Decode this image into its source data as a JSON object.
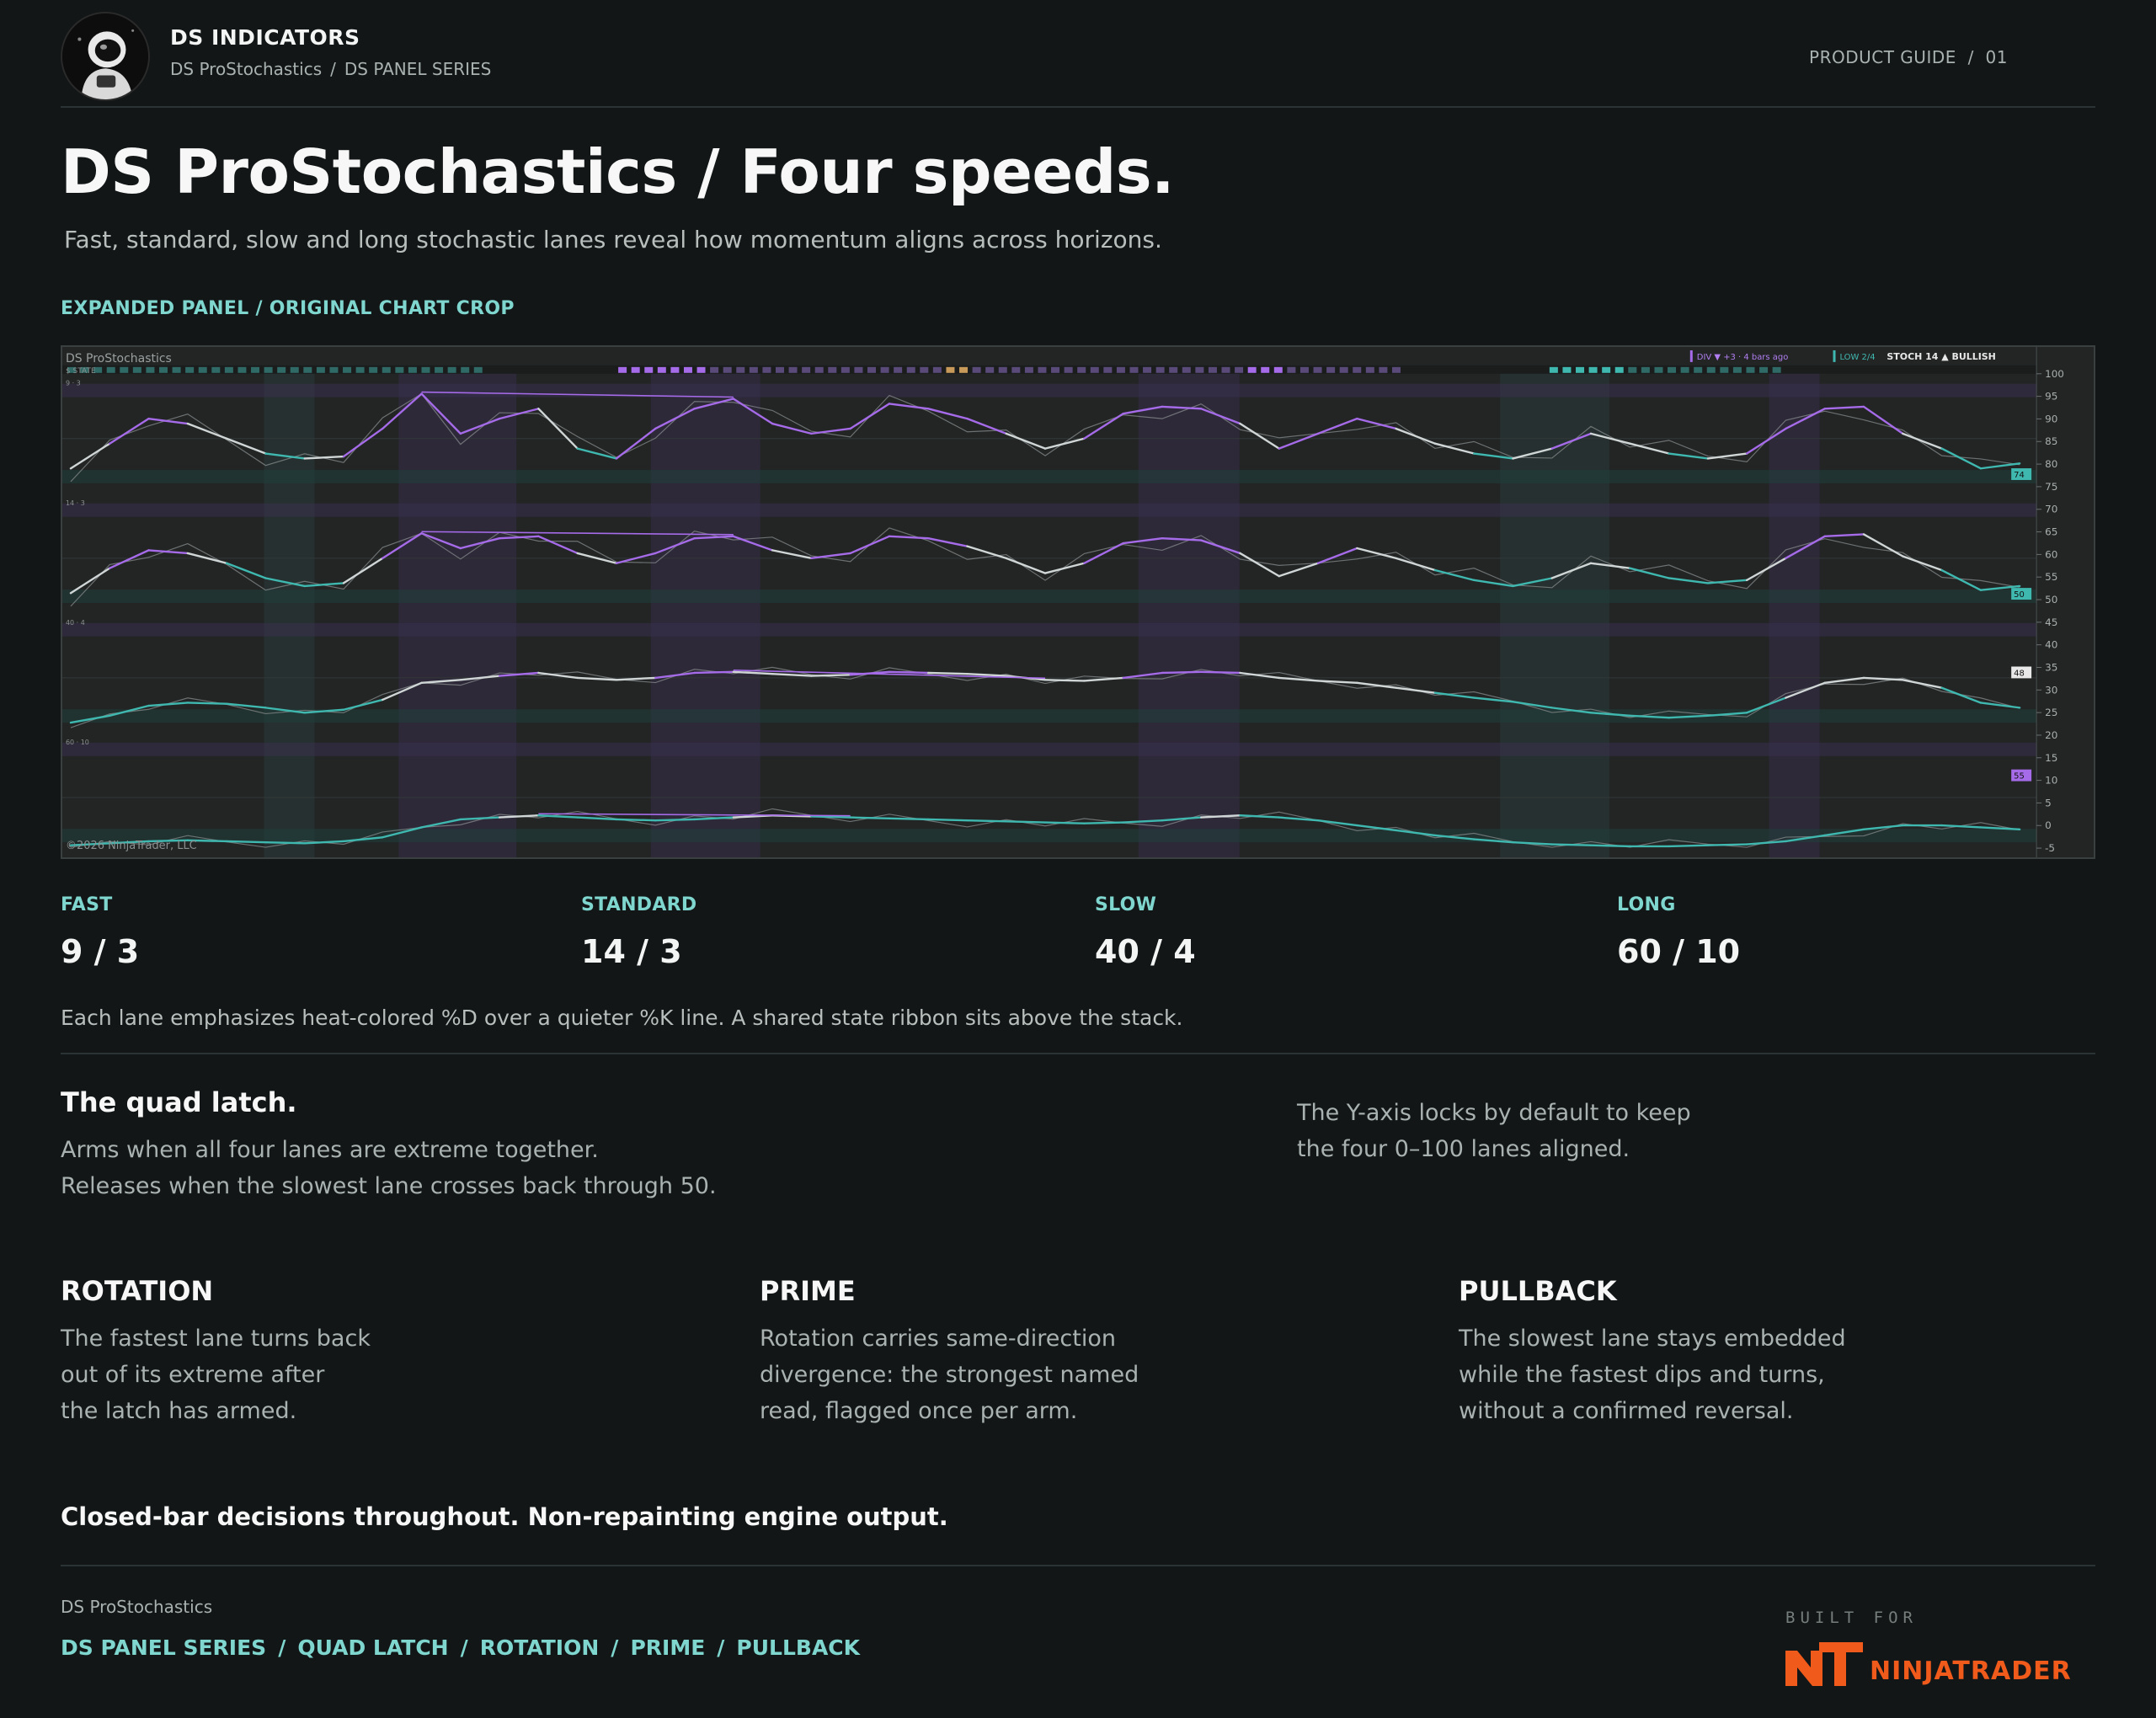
{
  "header": {
    "brand": "DS INDICATORS",
    "breadcrumb": [
      "DS ProStochastics",
      "DS PANEL SERIES"
    ],
    "breadcrumb_sep": "/",
    "guide": "PRODUCT GUIDE  /  01"
  },
  "hero": {
    "title": "DS ProStochastics / Four speeds.",
    "subtitle": "Fast, standard, slow and long stochastic lanes reveal how momentum aligns across horizons."
  },
  "chart_section": {
    "label": "EXPANDED PANEL / ORIGINAL CHART CROP",
    "panel_title": "DS ProStochastics",
    "state_label": "$  STATE",
    "badge_div": "DIV ▼  +3 · 4 bars ago",
    "badge_low": "LOW 2/4",
    "badge_stoch": "STOCH 14  ▲ BULLISH",
    "lane_tags": [
      "9 · 3",
      "14 · 3",
      "40 · 4",
      "60 · 10"
    ],
    "copyright": "©2026 NinjaTrader, LLC",
    "y_ticks": [
      "100",
      "95",
      "90",
      "85",
      "80",
      "75",
      "70",
      "65",
      "60",
      "55",
      "50",
      "45",
      "40",
      "35",
      "30",
      "25",
      "20",
      "15",
      "10",
      "5",
      "0",
      "-5"
    ],
    "axis_markers": [
      "74",
      "50",
      "48",
      "55"
    ]
  },
  "chart_data": {
    "type": "line",
    "title": "DS ProStochastics",
    "ylim": [
      -5,
      100
    ],
    "lanes": [
      {
        "name": "9 · 3",
        "series": [
          {
            "name": "%D",
            "values": [
              20,
              45,
              70,
              65,
              50,
              35,
              30,
              32,
              60,
              95,
              55,
              70,
              80,
              40,
              30,
              60,
              80,
              90,
              65,
              55,
              60,
              85,
              80,
              70,
              55,
              40,
              50,
              75,
              82,
              80,
              65,
              40,
              55,
              70,
              60,
              45,
              35,
              30,
              40,
              55,
              45,
              35,
              30,
              35,
              60,
              80,
              82,
              55,
              40,
              20,
              25
            ]
          }
        ]
      },
      {
        "name": "14 · 3",
        "series": [
          {
            "name": "%D",
            "values": [
              15,
              40,
              58,
              55,
              45,
              30,
              22,
              25,
              50,
              75,
              60,
              70,
              72,
              55,
              45,
              55,
              70,
              72,
              58,
              50,
              55,
              72,
              70,
              62,
              50,
              35,
              45,
              65,
              70,
              68,
              55,
              32,
              45,
              60,
              50,
              38,
              28,
              22,
              30,
              45,
              40,
              30,
              25,
              28,
              50,
              72,
              74,
              52,
              38,
              18,
              22
            ]
          }
        ]
      },
      {
        "name": "40 · 4",
        "series": [
          {
            "name": "%D",
            "values": [
              5,
              12,
              22,
              25,
              24,
              20,
              15,
              18,
              28,
              45,
              48,
              52,
              55,
              50,
              48,
              50,
              55,
              56,
              54,
              52,
              53,
              56,
              55,
              54,
              52,
              48,
              47,
              50,
              55,
              56,
              55,
              50,
              47,
              45,
              40,
              35,
              30,
              26,
              20,
              15,
              12,
              10,
              12,
              15,
              30,
              45,
              50,
              48,
              40,
              25,
              20
            ]
          }
        ]
      },
      {
        "name": "60 · 10",
        "series": [
          {
            "name": "%D",
            "values": [
              2,
              4,
              6,
              7,
              6,
              5,
              4,
              6,
              10,
              20,
              28,
              30,
              32,
              30,
              28,
              27,
              28,
              30,
              32,
              31,
              30,
              29,
              28,
              27,
              26,
              25,
              24,
              25,
              27,
              30,
              32,
              30,
              27,
              22,
              17,
              12,
              8,
              5,
              3,
              2,
              1,
              1,
              2,
              3,
              6,
              12,
              18,
              22,
              22,
              20,
              18
            ]
          }
        ]
      }
    ]
  },
  "lanes": [
    {
      "label": "FAST",
      "value": "9 / 3"
    },
    {
      "label": "STANDARD",
      "value": "14 / 3"
    },
    {
      "label": "SLOW",
      "value": "40 / 4"
    },
    {
      "label": "LONG",
      "value": "60 / 10"
    }
  ],
  "lane_note": "Each lane emphasizes heat-colored %D over a quieter %K line. A shared state ribbon sits above the stack.",
  "quad": {
    "title": "The quad latch.",
    "lines": [
      "Arms when all four lanes are extreme together.",
      "Releases when the slowest lane crosses back through 50."
    ],
    "side_lines": [
      "The Y-axis locks by default to keep",
      "the four 0–100 lanes aligned."
    ]
  },
  "features": [
    {
      "title": "ROTATION",
      "lines": [
        "The fastest lane turns back",
        "out of its extreme after",
        "the latch has armed."
      ]
    },
    {
      "title": "PRIME",
      "lines": [
        "Rotation carries same-direction",
        "divergence: the strongest named",
        "read, flagged once per arm."
      ]
    },
    {
      "title": "PULLBACK",
      "lines": [
        "The slowest lane stays embedded",
        "while the fastest dips and turns,",
        "without a confirmed reversal."
      ]
    }
  ],
  "tagline": "Closed-bar decisions throughout. Non-repainting engine output.",
  "footer": {
    "product": "DS ProStochastics",
    "links": [
      "DS PANEL SERIES",
      "QUAD LATCH",
      "ROTATION",
      "PRIME",
      "PULLBACK"
    ],
    "built_for": "BUILT FOR",
    "partner": "NINJATRADER"
  },
  "colors": {
    "accent": "#7fd6cf",
    "purple": "#a56be8",
    "teal": "#3fb8b0",
    "brand_orange": "#f05a1a",
    "bg": "#121617"
  }
}
